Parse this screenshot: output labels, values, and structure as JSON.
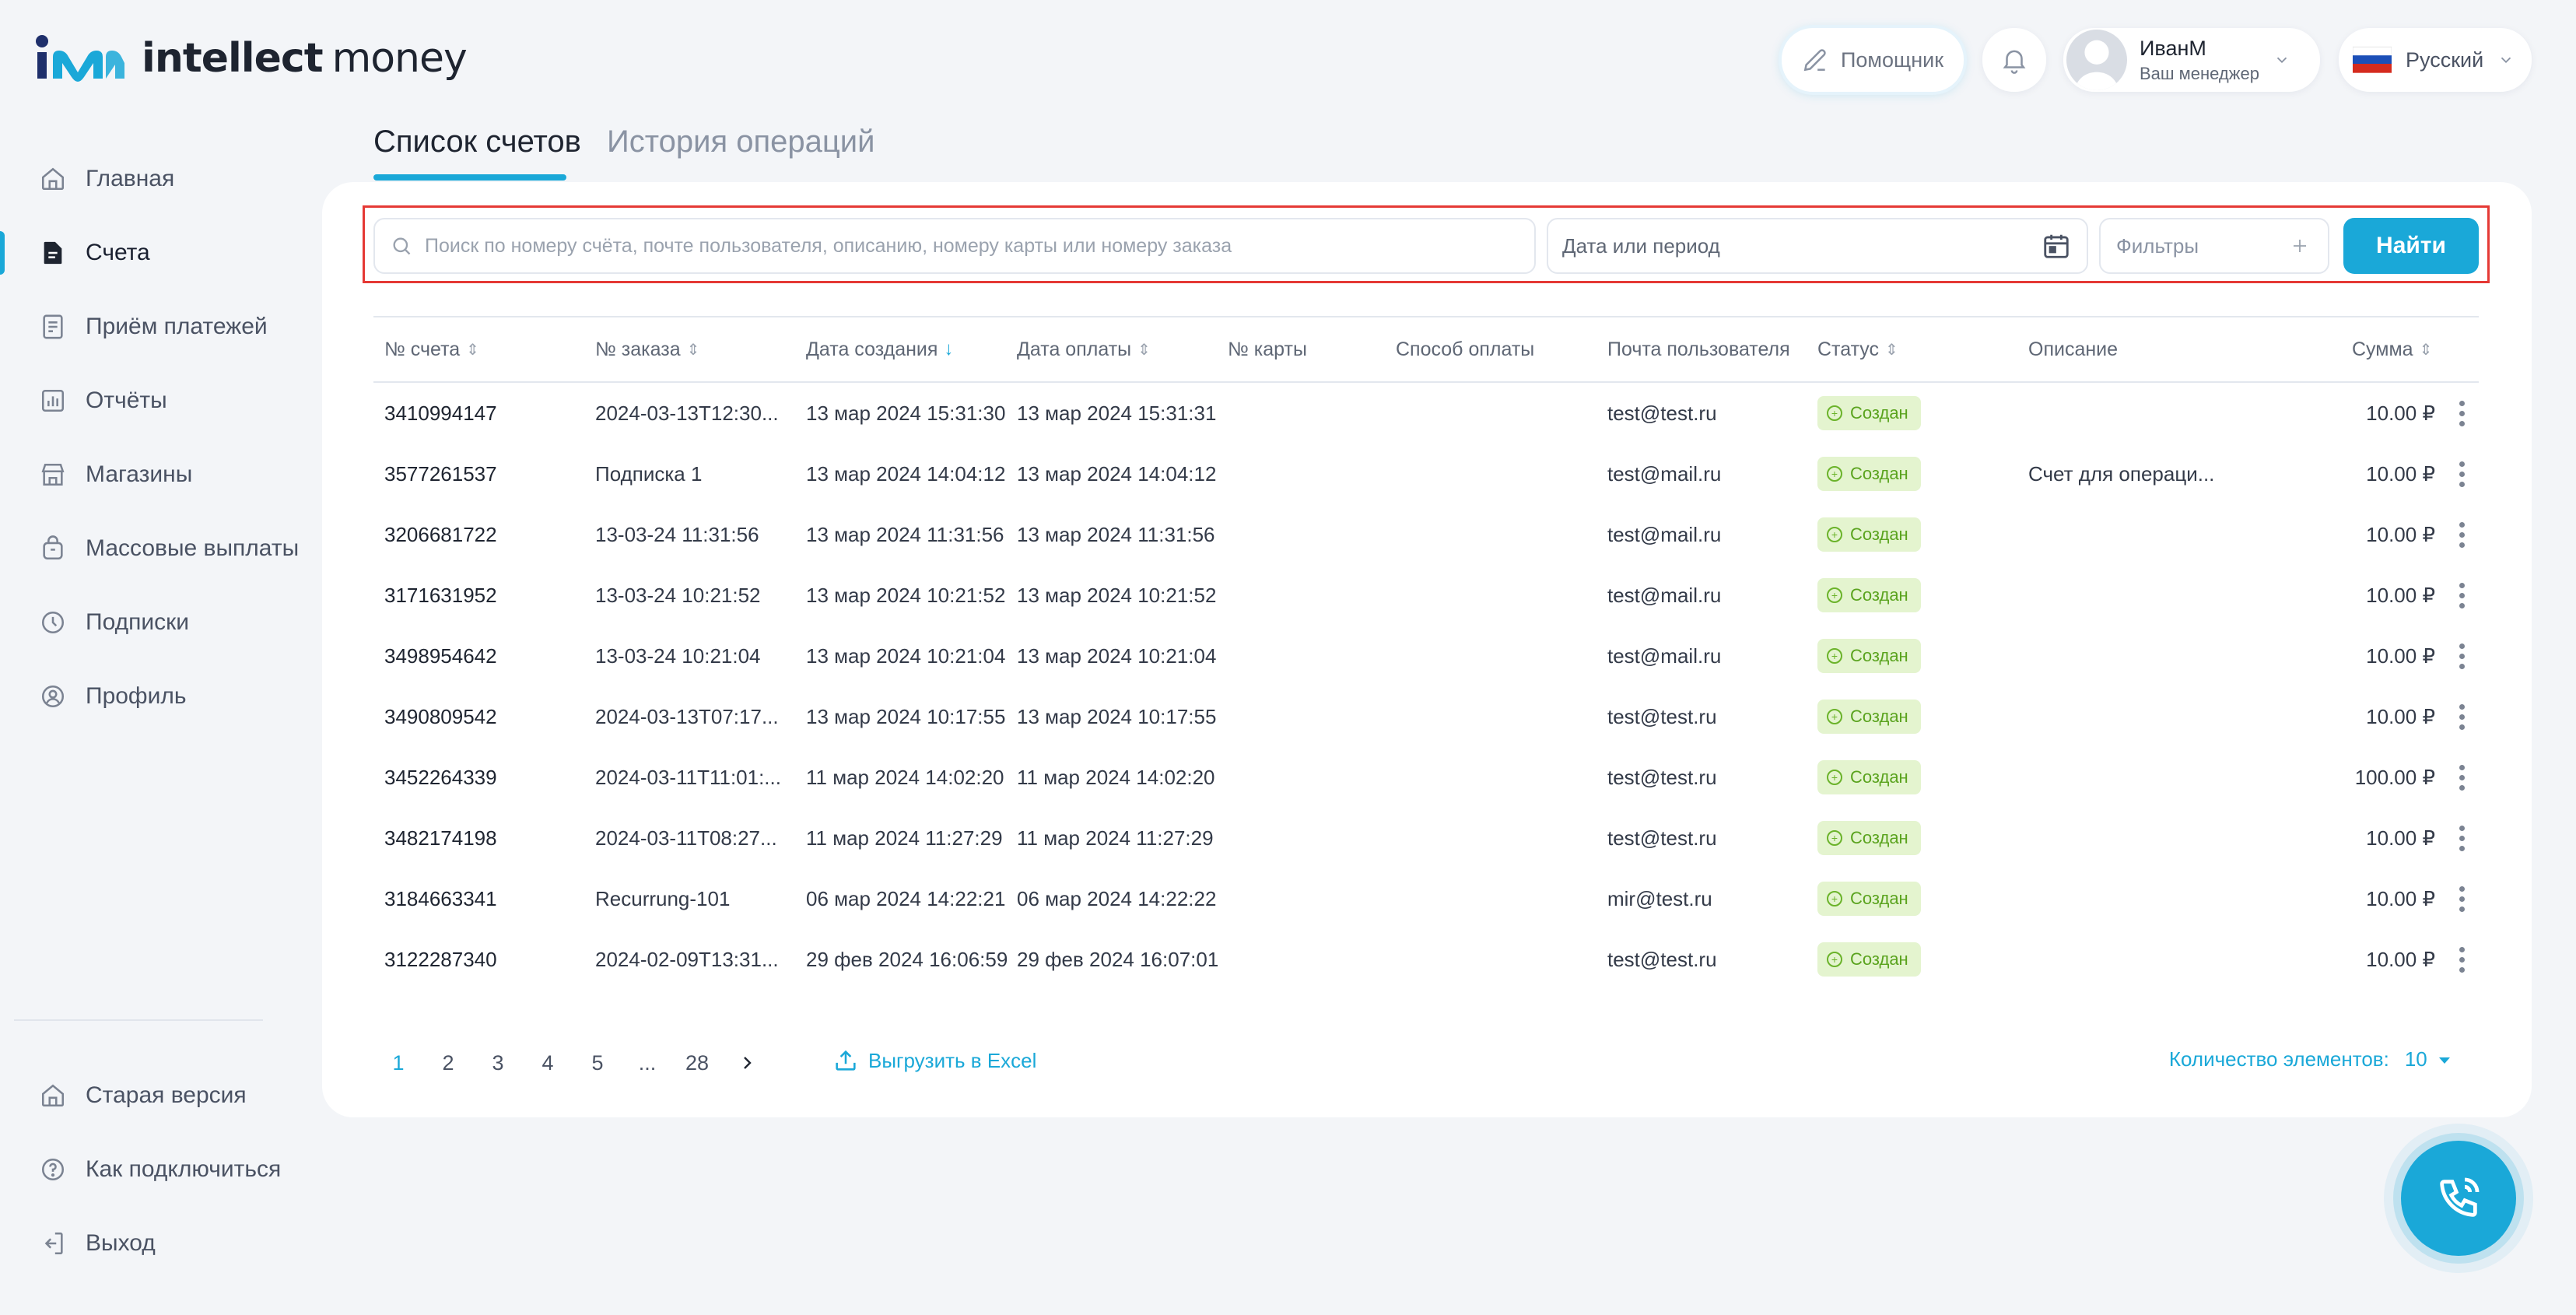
{
  "brand": {
    "logo_text_bold": "intellect",
    "logo_text_regular": "money"
  },
  "header": {
    "assistant_label": "Помощник",
    "user_name": "ИванМ",
    "user_role": "Ваш менеджер",
    "language": "Русский"
  },
  "sidebar": {
    "items": [
      {
        "label": "Главная",
        "icon": "home-icon"
      },
      {
        "label": "Счета",
        "icon": "document-icon",
        "active": true
      },
      {
        "label": "Приём платежей",
        "icon": "receipt-icon"
      },
      {
        "label": "Отчёты",
        "icon": "chart-icon"
      },
      {
        "label": "Магазины",
        "icon": "store-icon"
      },
      {
        "label": "Массовые выплаты",
        "icon": "bag-icon"
      },
      {
        "label": "Подписки",
        "icon": "clock-icon"
      },
      {
        "label": "Профиль",
        "icon": "user-circle-icon"
      }
    ],
    "bottom": [
      {
        "label": "Старая версия",
        "icon": "home-icon"
      },
      {
        "label": "Как подключиться",
        "icon": "question-icon"
      },
      {
        "label": "Выход",
        "icon": "logout-icon"
      }
    ]
  },
  "tabs": [
    {
      "label": "Список счетов",
      "active": true
    },
    {
      "label": "История операций",
      "active": false
    }
  ],
  "search": {
    "placeholder": "Поиск по номеру счёта, почте пользователя, описанию, номеру карты или номеру заказа",
    "date_placeholder": "Дата или период",
    "filters_label": "Фильтры",
    "find_button": "Найти"
  },
  "table": {
    "columns": [
      {
        "label": "№ счета",
        "sortable": true
      },
      {
        "label": "№ заказа",
        "sortable": true
      },
      {
        "label": "Дата создания",
        "sortable": true,
        "sorted": "desc"
      },
      {
        "label": "Дата оплаты",
        "sortable": true
      },
      {
        "label": "№ карты",
        "sortable": false
      },
      {
        "label": "Способ оплаты",
        "sortable": false
      },
      {
        "label": "Почта пользователя",
        "sortable": false
      },
      {
        "label": "Статус",
        "sortable": true
      },
      {
        "label": "Описание",
        "sortable": false
      },
      {
        "label": "Сумма",
        "sortable": true
      }
    ],
    "rows": [
      {
        "id": "3410994147",
        "order": "2024-03-13T12:30...",
        "created": "13 мар 2024 15:31:30",
        "paid": "13 мар 2024 15:31:31",
        "card": "",
        "method": "",
        "email": "test@test.ru",
        "status": "Создан",
        "description": "",
        "amount": "10.00 ₽"
      },
      {
        "id": "3577261537",
        "order": "Подписка 1",
        "created": "13 мар 2024 14:04:12",
        "paid": "13 мар 2024 14:04:12",
        "card": "",
        "method": "",
        "email": "test@mail.ru",
        "status": "Создан",
        "description": "Счет для операци...",
        "amount": "10.00 ₽"
      },
      {
        "id": "3206681722",
        "order": "13-03-24 11:31:56",
        "created": "13 мар 2024 11:31:56",
        "paid": "13 мар 2024 11:31:56",
        "card": "",
        "method": "",
        "email": "test@mail.ru",
        "status": "Создан",
        "description": "",
        "amount": "10.00 ₽"
      },
      {
        "id": "3171631952",
        "order": "13-03-24 10:21:52",
        "created": "13 мар 2024 10:21:52",
        "paid": "13 мар 2024 10:21:52",
        "card": "",
        "method": "",
        "email": "test@mail.ru",
        "status": "Создан",
        "description": "",
        "amount": "10.00 ₽"
      },
      {
        "id": "3498954642",
        "order": "13-03-24 10:21:04",
        "created": "13 мар 2024 10:21:04",
        "paid": "13 мар 2024 10:21:04",
        "card": "",
        "method": "",
        "email": "test@mail.ru",
        "status": "Создан",
        "description": "",
        "amount": "10.00 ₽"
      },
      {
        "id": "3490809542",
        "order": "2024-03-13T07:17...",
        "created": "13 мар 2024 10:17:55",
        "paid": "13 мар 2024 10:17:55",
        "card": "",
        "method": "",
        "email": "test@test.ru",
        "status": "Создан",
        "description": "",
        "amount": "10.00 ₽"
      },
      {
        "id": "3452264339",
        "order": "2024-03-11T11:01:...",
        "created": "11 мар 2024 14:02:20",
        "paid": "11 мар 2024 14:02:20",
        "card": "",
        "method": "",
        "email": "test@test.ru",
        "status": "Создан",
        "description": "",
        "amount": "100.00 ₽"
      },
      {
        "id": "3482174198",
        "order": "2024-03-11T08:27...",
        "created": "11 мар 2024 11:27:29",
        "paid": "11 мар 2024 11:27:29",
        "card": "",
        "method": "",
        "email": "test@test.ru",
        "status": "Создан",
        "description": "",
        "amount": "10.00 ₽"
      },
      {
        "id": "3184663341",
        "order": "Recurrung-101",
        "created": "06 мар 2024 14:22:21",
        "paid": "06 мар 2024 14:22:22",
        "card": "",
        "method": "",
        "email": "mir@test.ru",
        "status": "Создан",
        "description": "",
        "amount": "10.00 ₽"
      },
      {
        "id": "3122287340",
        "order": "2024-02-09T13:31...",
        "created": "29 фев 2024 16:06:59",
        "paid": "29 фев 2024 16:07:01",
        "card": "",
        "method": "",
        "email": "test@test.ru",
        "status": "Создан",
        "description": "",
        "amount": "10.00 ₽"
      }
    ]
  },
  "pagination": {
    "pages": [
      "1",
      "2",
      "3",
      "4",
      "5",
      "...",
      "28"
    ],
    "current": "1",
    "export_label": "Выгрузить в Excel",
    "per_page_label": "Количество элементов:",
    "per_page_value": "10"
  },
  "colors": {
    "accent": "#1aa8d8",
    "status_bg": "#e4f4cf",
    "status_text": "#5aa31e",
    "highlight_border": "#e53935"
  }
}
